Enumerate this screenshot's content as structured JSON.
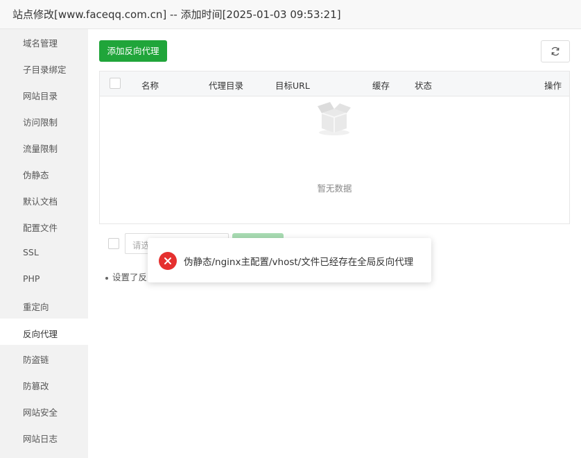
{
  "window": {
    "title": "站点修改[www.faceqq.com.cn] -- 添加时间[2025-01-03 09:53:21]"
  },
  "sidebar": {
    "items": [
      {
        "label": "域名管理"
      },
      {
        "label": "子目录绑定"
      },
      {
        "label": "网站目录"
      },
      {
        "label": "访问限制"
      },
      {
        "label": "流量限制"
      },
      {
        "label": "伪静态"
      },
      {
        "label": "默认文档"
      },
      {
        "label": "配置文件"
      },
      {
        "label": "SSL"
      },
      {
        "label": "PHP"
      },
      {
        "label": "重定向"
      },
      {
        "label": "反向代理",
        "active": true
      },
      {
        "label": "防盗链"
      },
      {
        "label": "防篡改"
      },
      {
        "label": "网站安全"
      },
      {
        "label": "网站日志"
      }
    ]
  },
  "toolbar": {
    "add_label": "添加反向代理",
    "refresh_icon": "refresh-icon"
  },
  "table": {
    "columns": [
      "名称",
      "代理目录",
      "目标URL",
      "缓存",
      "状态",
      "操作"
    ],
    "rows": [],
    "empty_text": "暂无数据"
  },
  "bottom": {
    "select_placeholder": "请选",
    "note": "设置了反向"
  },
  "toast": {
    "type": "error",
    "message": "伪静态/nginx主配置/vhost/文件已经存在全局反向代理"
  },
  "colors": {
    "primary": "#20a53a",
    "error": "#e5302f"
  }
}
